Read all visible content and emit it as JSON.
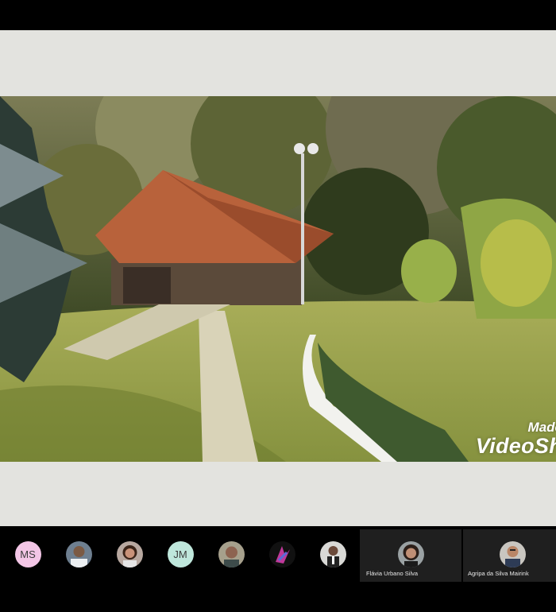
{
  "screen_share": {
    "watermark_line1": "Made",
    "watermark_line2": "VideoSh"
  },
  "participants": [
    {
      "initials": "MS",
      "avatar_color": "#f3c6e6",
      "type": "initials"
    },
    {
      "type": "photo",
      "photo": "person-1"
    },
    {
      "type": "photo",
      "photo": "person-2"
    },
    {
      "initials": "JM",
      "avatar_color": "#bfe7dc",
      "type": "initials"
    },
    {
      "type": "photo",
      "photo": "person-3"
    },
    {
      "type": "photo",
      "photo": "person-4"
    },
    {
      "type": "photo",
      "photo": "person-5"
    },
    {
      "type": "photo",
      "name": "Flávia Urbano Silva"
    },
    {
      "type": "photo",
      "name": "Agripa da Silva Mairink"
    }
  ]
}
